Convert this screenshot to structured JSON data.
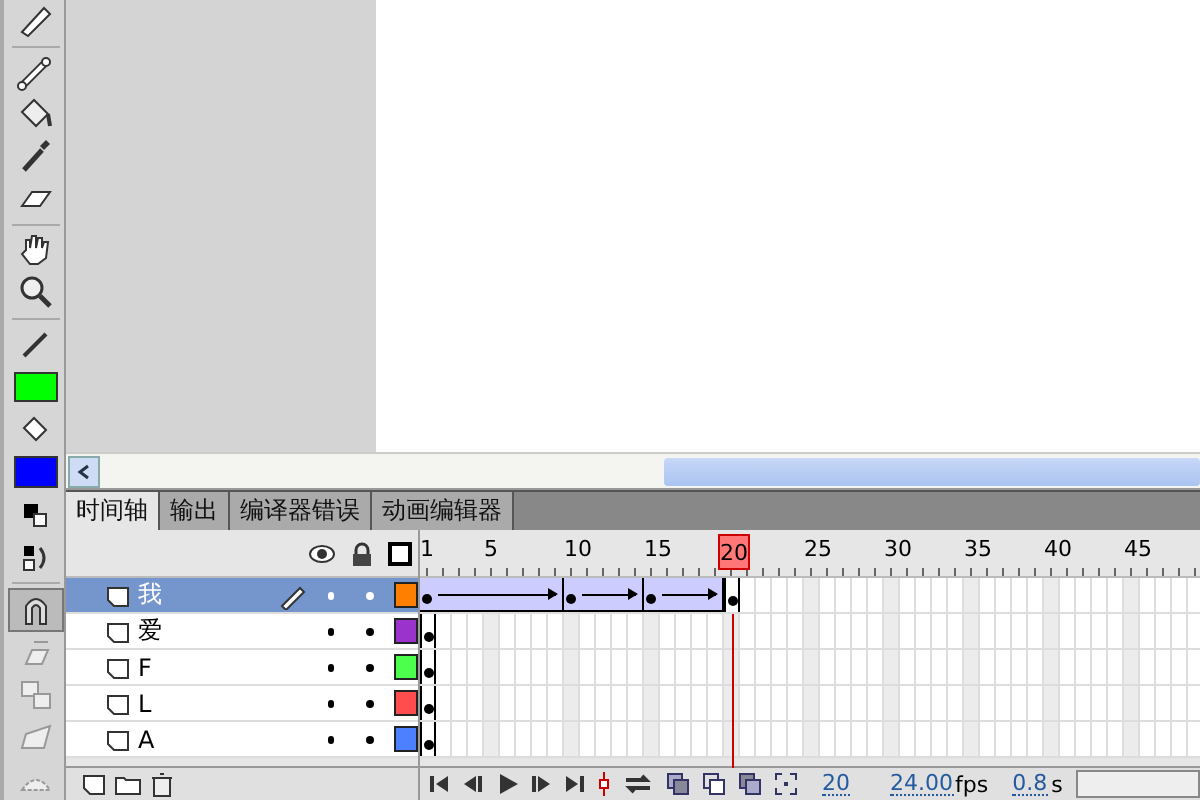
{
  "tabs": [
    {
      "label": "时间轴",
      "selected": true
    },
    {
      "label": "输出",
      "selected": false
    },
    {
      "label": "编译器错误",
      "selected": false
    },
    {
      "label": "动画编辑器",
      "selected": false
    }
  ],
  "ruler": [
    {
      "label": "1",
      "selected": false
    },
    {
      "label": "5",
      "selected": false
    },
    {
      "label": "10",
      "selected": false
    },
    {
      "label": "15",
      "selected": false
    },
    {
      "label": "20",
      "selected": true
    },
    {
      "label": "25",
      "selected": false
    },
    {
      "label": "30",
      "selected": false
    },
    {
      "label": "35",
      "selected": false
    },
    {
      "label": "40",
      "selected": false
    },
    {
      "label": "45",
      "selected": false
    }
  ],
  "layers": [
    {
      "name": "我",
      "selected": true,
      "editing": true,
      "color": "#ff8000",
      "frames": [
        {
          "kind": "tween_key"
        },
        {
          "kind": "tween"
        },
        {
          "kind": "tween"
        },
        {
          "kind": "tween"
        },
        {
          "kind": "tween"
        },
        {
          "kind": "tween"
        },
        {
          "kind": "tween"
        },
        {
          "kind": "tween"
        },
        {
          "kind": "tween"
        },
        {
          "kind": "tween_key"
        },
        {
          "kind": "tween"
        },
        {
          "kind": "tween"
        },
        {
          "kind": "tween"
        },
        {
          "kind": "tween"
        },
        {
          "kind": "tween_key"
        },
        {
          "kind": "tween"
        },
        {
          "kind": "tween"
        },
        {
          "kind": "tween"
        },
        {
          "kind": "tween"
        },
        {
          "kind": "key"
        }
      ]
    },
    {
      "name": "爱",
      "selected": false,
      "editing": false,
      "color": "#9933cc",
      "frames": [
        {
          "kind": "key"
        }
      ]
    },
    {
      "name": "F",
      "selected": false,
      "editing": false,
      "color": "#4dff4d",
      "frames": [
        {
          "kind": "key"
        }
      ]
    },
    {
      "name": "L",
      "selected": false,
      "editing": false,
      "color": "#ff4d4d",
      "frames": [
        {
          "kind": "key"
        }
      ]
    },
    {
      "name": "A",
      "selected": false,
      "editing": false,
      "color": "#4d80ff",
      "frames": [
        {
          "kind": "key"
        }
      ]
    }
  ],
  "status": {
    "frame": "20",
    "rate": "24.00",
    "rate_unit": "fps",
    "time": "0.8",
    "time_unit": "s"
  }
}
